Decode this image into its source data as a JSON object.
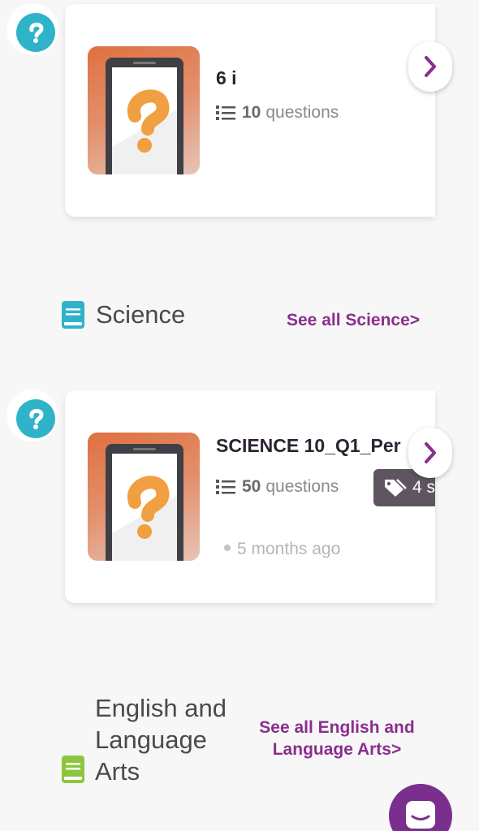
{
  "cards": [
    {
      "title": "6 i",
      "question_count": "10",
      "questions_label": "questions"
    },
    {
      "title": "SCIENCE 10_Q1_Per",
      "question_count": "50",
      "questions_label": "questions",
      "tag_text": "4 s",
      "time": "5 months ago"
    }
  ],
  "sections": {
    "science": {
      "name": "Science",
      "see_all": "See all Science>",
      "icon_color": "#2fb3c8"
    },
    "english": {
      "name": "English and Language Arts",
      "see_all": "See all English and Language Arts>",
      "icon_color": "#8cc63f"
    }
  },
  "colors": {
    "accent_purple": "#8a2e8e",
    "badge_teal": "#2fb3c8",
    "quiz_orange": "#f0a040",
    "tag_bg": "#5e5560"
  }
}
